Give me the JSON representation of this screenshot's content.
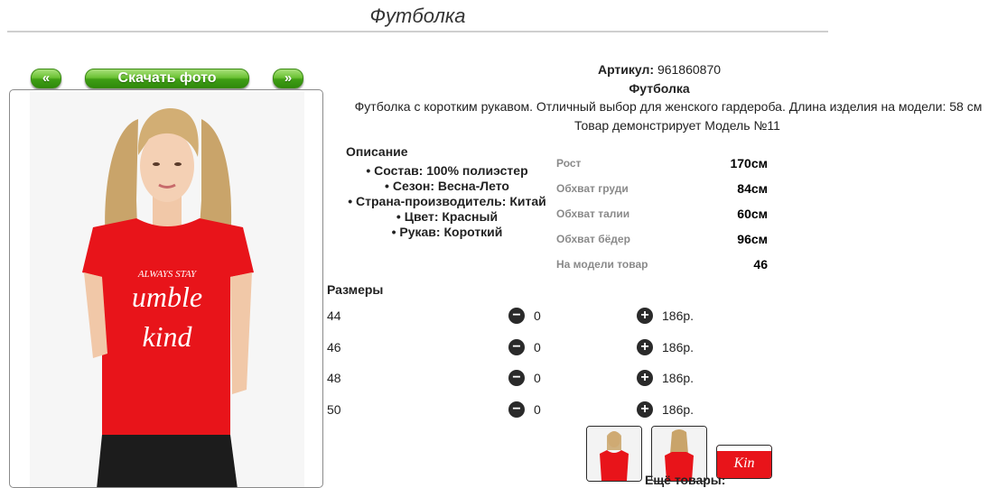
{
  "page": {
    "title": "Футболка"
  },
  "gallery": {
    "prev_label": "«",
    "download_label": "Скачать фото",
    "next_label": "»"
  },
  "product": {
    "article_label": "Артикул:",
    "article_value": "961860870",
    "name": "Футболка",
    "description": "Футболка с коротким рукавом. Отличный выбор для женского гардероба. Длина изделия на модели: 58 см",
    "model_line": "Товар демонстрирует Модель №11"
  },
  "description": {
    "title": "Описание",
    "items": [
      "Состав: 100% полиэстер",
      "Сезон: Весна-Лето",
      "Страна-производитель: Китай",
      "Цвет: Красный",
      "Рукав: Короткий"
    ]
  },
  "measurements": [
    {
      "label": "Рост",
      "value": "170см"
    },
    {
      "label": "Обхват груди",
      "value": "84см"
    },
    {
      "label": "Обхват талии",
      "value": "60см"
    },
    {
      "label": "Обхват бёдер",
      "value": "96см"
    },
    {
      "label": "На модели товар",
      "value": "46"
    }
  ],
  "sizes": {
    "title": "Размеры",
    "minus_icon": "−",
    "plus_icon": "+",
    "rows": [
      {
        "size": "44",
        "qty": "0",
        "price": "186р."
      },
      {
        "size": "46",
        "qty": "0",
        "price": "186р."
      },
      {
        "size": "48",
        "qty": "0",
        "price": "186р."
      },
      {
        "size": "50",
        "qty": "0",
        "price": "186р."
      }
    ]
  },
  "footer": {
    "more_goods": "Ещё товары:"
  },
  "colors": {
    "accent_green": "#4caf1f",
    "shirt_red": "#e8141a"
  }
}
